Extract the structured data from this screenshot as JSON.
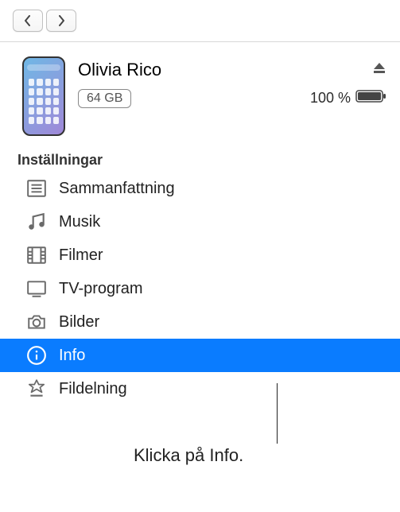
{
  "nav": {
    "back": "back",
    "forward": "forward"
  },
  "device": {
    "name": "Olivia Rico",
    "capacity": "64 GB",
    "battery_pct": "100 %"
  },
  "section_title": "Inställningar",
  "sidebar": {
    "items": [
      {
        "label": "Sammanfattning"
      },
      {
        "label": "Musik"
      },
      {
        "label": "Filmer"
      },
      {
        "label": "TV-program"
      },
      {
        "label": "Bilder"
      },
      {
        "label": "Info"
      },
      {
        "label": "Fildelning"
      }
    ],
    "selected_index": 5
  },
  "callout": "Klicka på Info."
}
